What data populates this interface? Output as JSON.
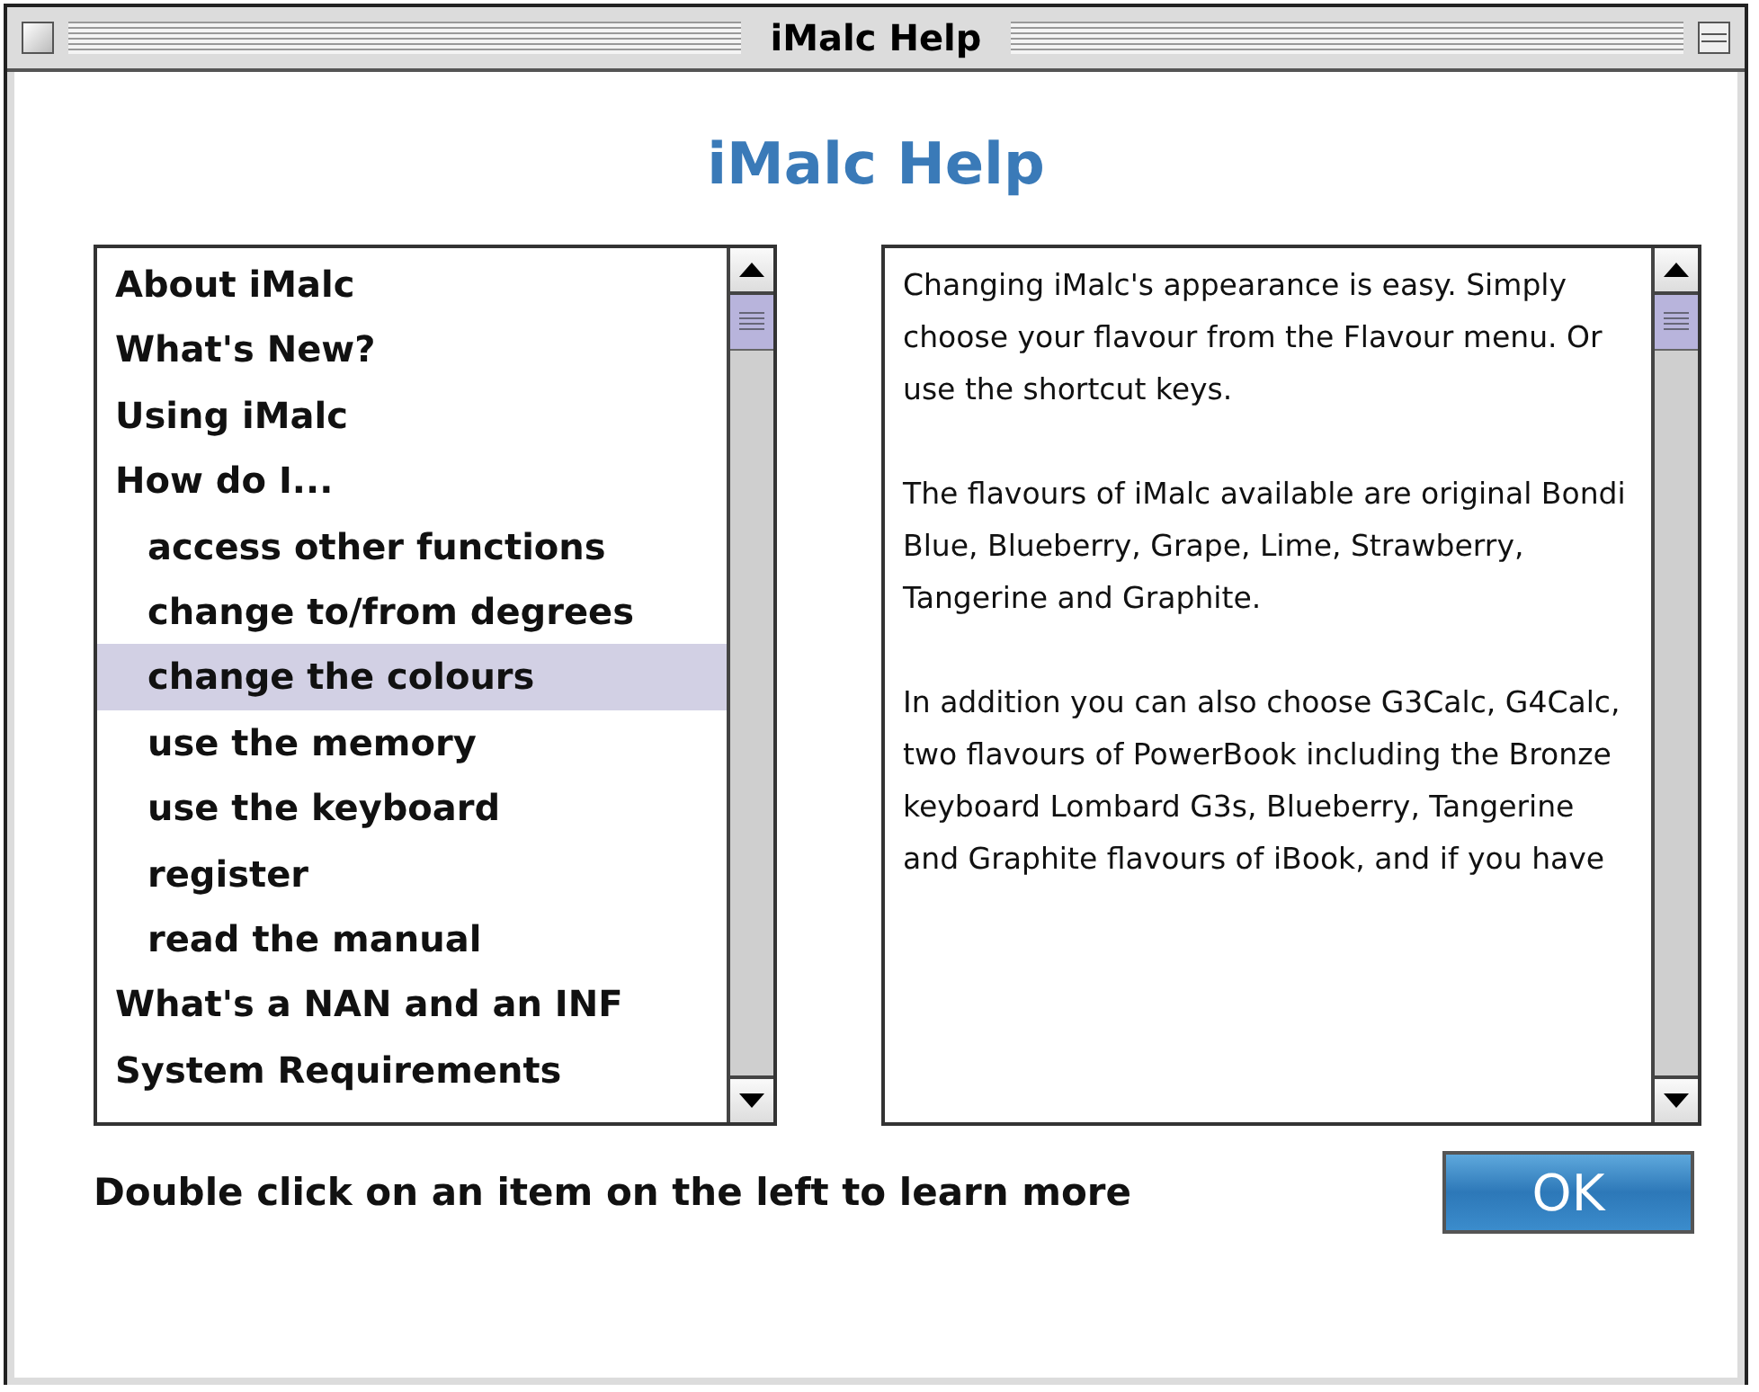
{
  "window": {
    "title": "iMalc Help"
  },
  "heading": "iMalc Help",
  "topics": [
    {
      "label": "About iMalc",
      "selected": false
    },
    {
      "label": "What's New?",
      "selected": false
    },
    {
      "label": "Using iMalc",
      "selected": false
    },
    {
      "label": "How do I...",
      "selected": false,
      "children": [
        {
          "label": "access other functions",
          "selected": false
        },
        {
          "label": "change to/from degrees",
          "selected": false
        },
        {
          "label": "change the colours",
          "selected": true
        },
        {
          "label": "use the memory",
          "selected": false
        },
        {
          "label": "use the keyboard",
          "selected": false
        },
        {
          "label": "register",
          "selected": false
        },
        {
          "label": "read the manual",
          "selected": false
        }
      ]
    },
    {
      "label": "What's a NAN and an INF",
      "selected": false
    },
    {
      "label": "System Requirements",
      "selected": false
    }
  ],
  "help_text": [
    "Changing iMalc's appearance is easy. Simply choose your flavour from the Flavour menu. Or use the shortcut keys.",
    "The flavours of iMalc available are original Bondi Blue, Blueberry, Grape, Lime, Strawberry, Tangerine and Graphite.",
    "In addition you can also choose G3Calc, G4Calc, two flavours of PowerBook including the Bronze keyboard Lombard G3s, Blueberry, Tangerine and Graphite flavours of iBook, and if you have"
  ],
  "hint": "Double click on an item on the left to learn more",
  "ok_button": "OK"
}
